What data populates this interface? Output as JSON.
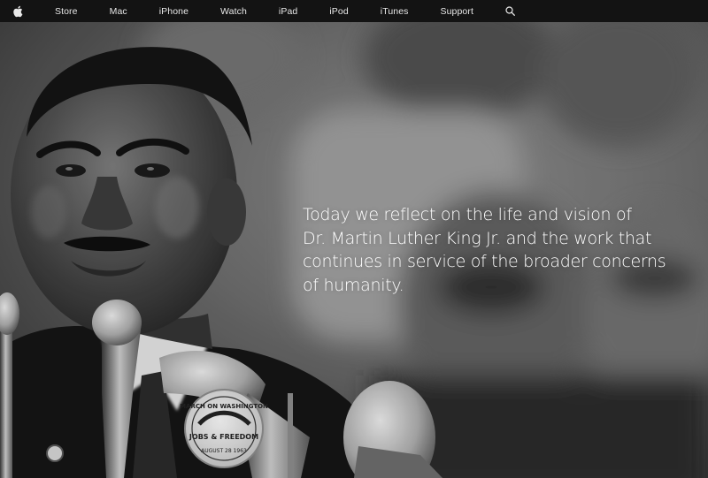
{
  "nav": {
    "items": [
      {
        "label": "Store"
      },
      {
        "label": "Mac"
      },
      {
        "label": "iPhone"
      },
      {
        "label": "Watch"
      },
      {
        "label": "iPad"
      },
      {
        "label": "iPod"
      },
      {
        "label": "iTunes"
      },
      {
        "label": "Support"
      }
    ],
    "icons": {
      "logo": "apple-logo-icon",
      "search": "search-icon"
    },
    "background": "#141414",
    "text_color": "#e8e8e8"
  },
  "hero": {
    "lines": [
      "Today we reflect on the life and vision of",
      "Dr. Martin Luther King Jr. and the work that",
      "continues in service of the broader concerns",
      "of humanity."
    ],
    "text_color": "#ffffff",
    "badge": {
      "line1": "MARCH ON WASHINGTON",
      "line2": "JOBS & FREEDOM",
      "line3": "AUGUST 28 1963"
    }
  }
}
